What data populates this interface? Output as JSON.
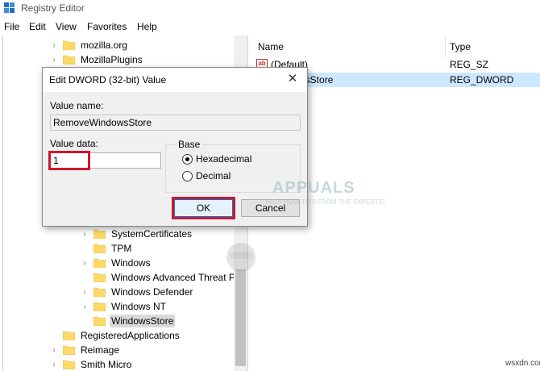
{
  "window": {
    "title": "Registry Editor"
  },
  "menu": [
    "File",
    "Edit",
    "View",
    "Favorites",
    "Help"
  ],
  "tree": [
    {
      "label": "mozilla.org",
      "expandable": true,
      "indent": 0
    },
    {
      "label": "MozillaPlugins",
      "expandable": true,
      "indent": 0
    },
    {
      "label": "SystemCertificates",
      "expandable": true,
      "indent": 1
    },
    {
      "label": "TPM",
      "expandable": false,
      "indent": 1
    },
    {
      "label": "Windows",
      "expandable": true,
      "indent": 1
    },
    {
      "label": "Windows Advanced Threat P",
      "expandable": false,
      "indent": 1
    },
    {
      "label": "Windows Defender",
      "expandable": true,
      "indent": 1
    },
    {
      "label": "Windows NT",
      "expandable": true,
      "indent": 1
    },
    {
      "label": "WindowsStore",
      "expandable": false,
      "indent": 1,
      "selected": true
    },
    {
      "label": "RegisteredApplications",
      "expandable": false,
      "indent": 0
    },
    {
      "label": "Reimage",
      "expandable": true,
      "indent": 0
    },
    {
      "label": "Smith Micro",
      "expandable": true,
      "indent": 0
    }
  ],
  "list": {
    "columns": {
      "name": "Name",
      "type": "Type"
    },
    "rows": [
      {
        "name": "(Default)",
        "type": "REG_SZ",
        "icon": "string-value-icon"
      },
      {
        "name": "WindowsStore",
        "type": "REG_DWORD",
        "icon": "dword-value-icon",
        "selected": true
      }
    ]
  },
  "dialog": {
    "title": "Edit DWORD (32-bit) Value",
    "value_name_label": "Value name:",
    "value_name": "RemoveWindowsStore",
    "value_data_label": "Value data:",
    "value_data": "1",
    "base_label": "Base",
    "radio_hex": "Hexadecimal",
    "radio_dec": "Decimal",
    "selected_base": "Hexadecimal",
    "ok_label": "OK",
    "cancel_label": "Cancel"
  },
  "watermark": {
    "brand": "APPUALS",
    "tagline": "TECH HOW-TO'S FROM THE EXPERTS!"
  },
  "site_watermark": "wsxdn.com",
  "colors": {
    "highlight": "#d2152f",
    "selection": "#cce8ff",
    "folder": "#ffd966"
  }
}
